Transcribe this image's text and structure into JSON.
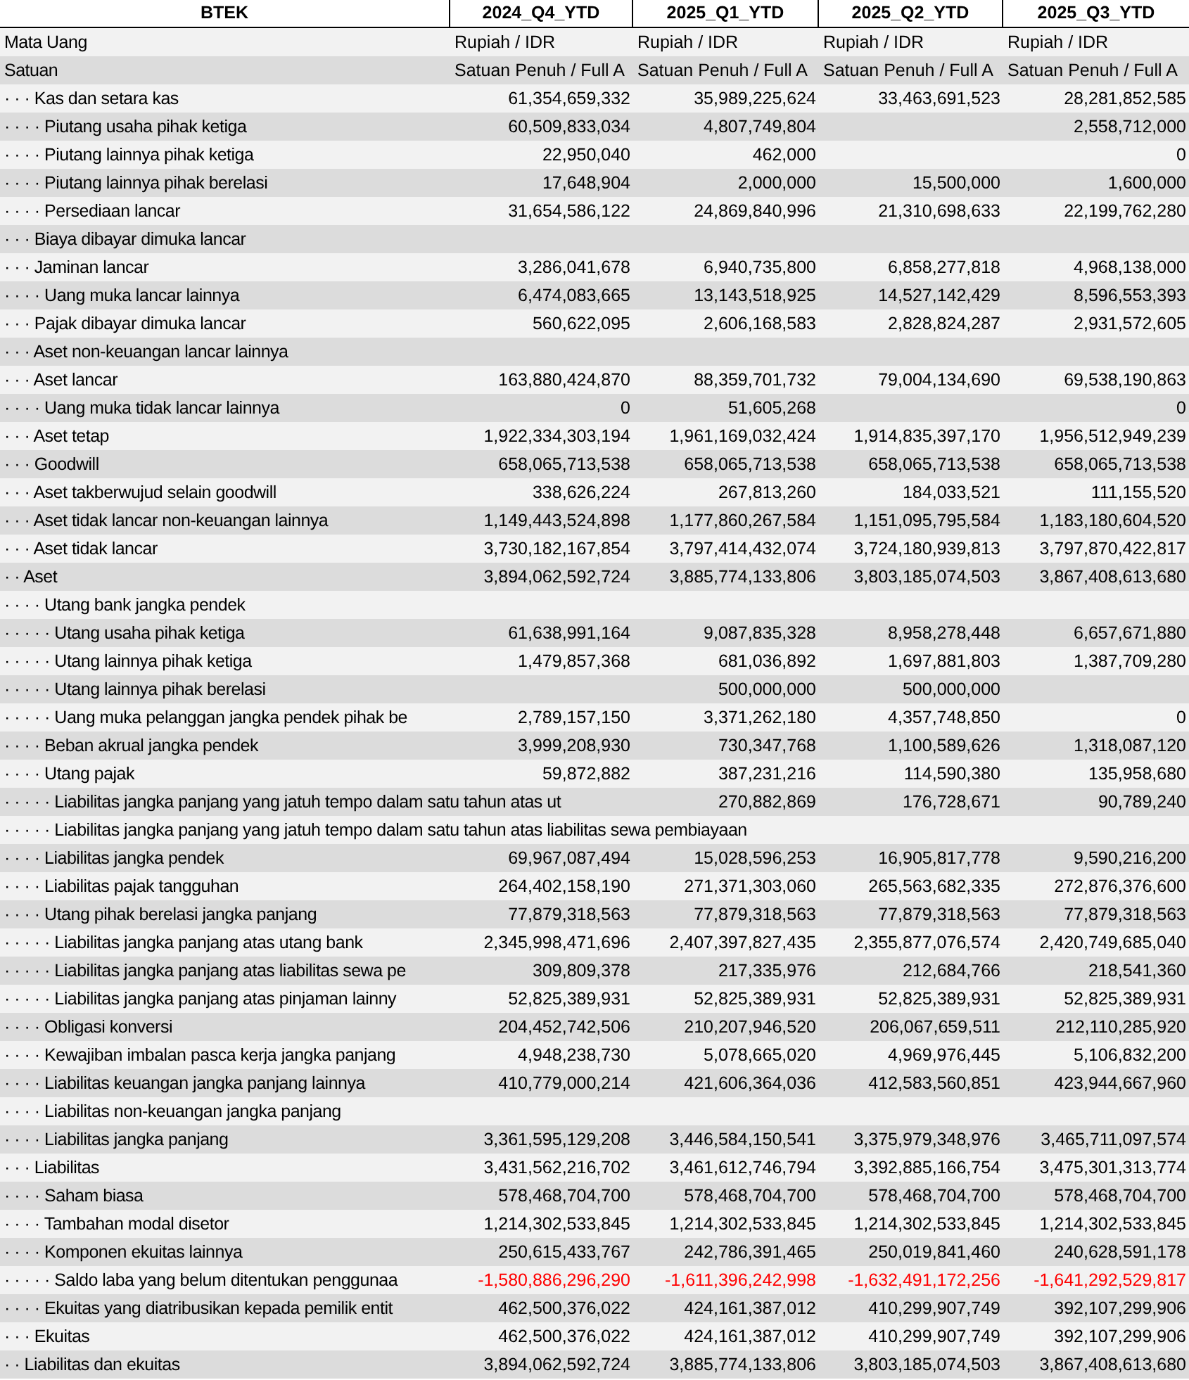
{
  "table": {
    "columns": [
      {
        "label": "BTEK"
      },
      {
        "label": "2024_Q4_YTD"
      },
      {
        "label": "2025_Q1_YTD"
      },
      {
        "label": "2025_Q2_YTD"
      },
      {
        "label": "2025_Q3_YTD"
      }
    ],
    "rows": [
      {
        "label": "Mata Uang",
        "values": {
          "col_1": "Rupiah / IDR",
          "col_2": "Rupiah / IDR",
          "col_3": "Rupiah / IDR",
          "col_4": "Rupiah / IDR"
        }
      },
      {
        "label": "Satuan",
        "values": {
          "col_1": "Satuan Penuh / Full A",
          "col_2": "Satuan Penuh / Full A",
          "col_3": "Satuan Penuh / Full A",
          "col_4": "Satuan Penuh / Full A"
        }
      },
      {
        "label": "· · · Kas dan setara kas",
        "values": {
          "col_1": "61,354,659,332",
          "col_2": "35,989,225,624",
          "col_3": "33,463,691,523",
          "col_4": "28,281,852,585"
        }
      },
      {
        "label": "· · · · Piutang usaha pihak ketiga",
        "values": {
          "col_1": "60,509,833,034",
          "col_2": "4,807,749,804",
          "col_4": "2,558,712,000"
        }
      },
      {
        "label": "· · · · Piutang lainnya pihak ketiga",
        "values": {
          "col_1": "22,950,040",
          "col_2": "462,000",
          "col_4": "0"
        }
      },
      {
        "label": "· · · · Piutang lainnya pihak berelasi",
        "values": {
          "col_1": "17,648,904",
          "col_2": "2,000,000",
          "col_3": "15,500,000",
          "col_4": "1,600,000"
        }
      },
      {
        "label": "· · · · Persediaan lancar",
        "values": {
          "col_1": "31,654,586,122",
          "col_2": "24,869,840,996",
          "col_3": "21,310,698,633",
          "col_4": "22,199,762,280"
        }
      },
      {
        "label": "· · · Biaya dibayar dimuka lancar"
      },
      {
        "label": "· · · Jaminan lancar",
        "values": {
          "col_1": "3,286,041,678",
          "col_2": "6,940,735,800",
          "col_3": "6,858,277,818",
          "col_4": "4,968,138,000"
        }
      },
      {
        "label": "· · · · Uang muka lancar lainnya",
        "values": {
          "col_1": "6,474,083,665",
          "col_2": "13,143,518,925",
          "col_3": "14,527,142,429",
          "col_4": "8,596,553,393"
        }
      },
      {
        "label": "· · · Pajak dibayar dimuka lancar",
        "values": {
          "col_1": "560,622,095",
          "col_2": "2,606,168,583",
          "col_3": "2,828,824,287",
          "col_4": "2,931,572,605"
        }
      },
      {
        "label": "· · · Aset non-keuangan lancar lainnya"
      },
      {
        "label": "· · · Aset lancar",
        "values": {
          "col_1": "163,880,424,870",
          "col_2": "88,359,701,732",
          "col_3": "79,004,134,690",
          "col_4": "69,538,190,863"
        }
      },
      {
        "label": "· · · · Uang muka tidak lancar lainnya",
        "values": {
          "col_1": "0",
          "col_2": "51,605,268",
          "col_4": "0"
        }
      },
      {
        "label": "· · · Aset tetap",
        "values": {
          "col_1": "1,922,334,303,194",
          "col_2": "1,961,169,032,424",
          "col_3": "1,914,835,397,170",
          "col_4": "1,956,512,949,239"
        }
      },
      {
        "label": "· · · Goodwill",
        "values": {
          "col_1": "658,065,713,538",
          "col_2": "658,065,713,538",
          "col_3": "658,065,713,538",
          "col_4": "658,065,713,538"
        }
      },
      {
        "label": "· · · Aset takberwujud selain goodwill",
        "values": {
          "col_1": "338,626,224",
          "col_2": "267,813,260",
          "col_3": "184,033,521",
          "col_4": "111,155,520"
        }
      },
      {
        "label": "· · · Aset tidak lancar non-keuangan lainnya",
        "values": {
          "col_1": "1,149,443,524,898",
          "col_2": "1,177,860,267,584",
          "col_3": "1,151,095,795,584",
          "col_4": "1,183,180,604,520"
        }
      },
      {
        "label": "· · · Aset tidak lancar",
        "values": {
          "col_1": "3,730,182,167,854",
          "col_2": "3,797,414,432,074",
          "col_3": "3,724,180,939,813",
          "col_4": "3,797,870,422,817"
        }
      },
      {
        "label": "· · Aset",
        "values": {
          "col_1": "3,894,062,592,724",
          "col_2": "3,885,774,133,806",
          "col_3": "3,803,185,074,503",
          "col_4": "3,867,408,613,680"
        }
      },
      {
        "label": "· · · · Utang bank jangka pendek"
      },
      {
        "label": "· · · · · Utang usaha pihak ketiga",
        "values": {
          "col_1": "61,638,991,164",
          "col_2": "9,087,835,328",
          "col_3": "8,958,278,448",
          "col_4": "6,657,671,880"
        }
      },
      {
        "label": "· · · · · Utang lainnya pihak ketiga",
        "values": {
          "col_1": "1,479,857,368",
          "col_2": "681,036,892",
          "col_3": "1,697,881,803",
          "col_4": "1,387,709,280"
        }
      },
      {
        "label": "· · · · · Utang lainnya pihak berelasi",
        "values": {
          "col_2": "500,000,000",
          "col_3": "500,000,000"
        }
      },
      {
        "label": "· · · · · Uang muka pelanggan jangka pendek pihak be",
        "values": {
          "col_1": "2,789,157,150",
          "col_2": "3,371,262,180",
          "col_3": "4,357,748,850",
          "col_4": "0"
        }
      },
      {
        "label": "· · · · Beban akrual jangka pendek",
        "values": {
          "col_1": "3,999,208,930",
          "col_2": "730,347,768",
          "col_3": "1,100,589,626",
          "col_4": "1,318,087,120"
        }
      },
      {
        "label": "· · · · Utang pajak",
        "values": {
          "col_1": "59,872,882",
          "col_2": "387,231,216",
          "col_3": "114,590,380",
          "col_4": "135,958,680"
        }
      },
      {
        "label": "· · · · · Liabilitas jangka panjang yang jatuh tempo dalam satu tahun atas ut",
        "values": {
          "col_2": "270,882,869",
          "col_3": "176,728,671",
          "col_4": "90,789,240"
        }
      },
      {
        "label": "· · · · · Liabilitas jangka panjang yang jatuh tempo dalam satu tahun atas liabilitas sewa pembiayaan"
      },
      {
        "label": "· · · · Liabilitas jangka pendek",
        "values": {
          "col_1": "69,967,087,494",
          "col_2": "15,028,596,253",
          "col_3": "16,905,817,778",
          "col_4": "9,590,216,200"
        }
      },
      {
        "label": "· · · · Liabilitas pajak tangguhan",
        "values": {
          "col_1": "264,402,158,190",
          "col_2": "271,371,303,060",
          "col_3": "265,563,682,335",
          "col_4": "272,876,376,600"
        }
      },
      {
        "label": "· · · · Utang pihak berelasi jangka panjang",
        "values": {
          "col_1": "77,879,318,563",
          "col_2": "77,879,318,563",
          "col_3": "77,879,318,563",
          "col_4": "77,879,318,563"
        }
      },
      {
        "label": "· · · · · Liabilitas jangka panjang atas utang bank",
        "values": {
          "col_1": "2,345,998,471,696",
          "col_2": "2,407,397,827,435",
          "col_3": "2,355,877,076,574",
          "col_4": "2,420,749,685,040"
        }
      },
      {
        "label": "· · · · · Liabilitas jangka panjang atas liabilitas sewa pe",
        "values": {
          "col_1": "309,809,378",
          "col_2": "217,335,976",
          "col_3": "212,684,766",
          "col_4": "218,541,360"
        }
      },
      {
        "label": "· · · · · Liabilitas jangka panjang atas pinjaman lainny",
        "values": {
          "col_1": "52,825,389,931",
          "col_2": "52,825,389,931",
          "col_3": "52,825,389,931",
          "col_4": "52,825,389,931"
        }
      },
      {
        "label": "· · · · Obligasi konversi",
        "values": {
          "col_1": "204,452,742,506",
          "col_2": "210,207,946,520",
          "col_3": "206,067,659,511",
          "col_4": "212,110,285,920"
        }
      },
      {
        "label": "· · · · Kewajiban imbalan pasca kerja jangka panjang",
        "values": {
          "col_1": "4,948,238,730",
          "col_2": "5,078,665,020",
          "col_3": "4,969,976,445",
          "col_4": "5,106,832,200"
        }
      },
      {
        "label": "· · · · Liabilitas keuangan jangka panjang lainnya",
        "values": {
          "col_1": "410,779,000,214",
          "col_2": "421,606,364,036",
          "col_3": "412,583,560,851",
          "col_4": "423,944,667,960"
        }
      },
      {
        "label": "· · · · Liabilitas non-keuangan jangka panjang"
      },
      {
        "label": "· · · · Liabilitas jangka panjang",
        "values": {
          "col_1": "3,361,595,129,208",
          "col_2": "3,446,584,150,541",
          "col_3": "3,375,979,348,976",
          "col_4": "3,465,711,097,574"
        }
      },
      {
        "label": "· · · Liabilitas",
        "values": {
          "col_1": "3,431,562,216,702",
          "col_2": "3,461,612,746,794",
          "col_3": "3,392,885,166,754",
          "col_4": "3,475,301,313,774"
        }
      },
      {
        "label": "· · · · Saham biasa",
        "values": {
          "col_1": "578,468,704,700",
          "col_2": "578,468,704,700",
          "col_3": "578,468,704,700",
          "col_4": "578,468,704,700"
        }
      },
      {
        "label": "· · · · Tambahan modal disetor",
        "values": {
          "col_1": "1,214,302,533,845",
          "col_2": "1,214,302,533,845",
          "col_3": "1,214,302,533,845",
          "col_4": "1,214,302,533,845"
        }
      },
      {
        "label": "· · · · Komponen ekuitas lainnya",
        "values": {
          "col_1": "250,615,433,767",
          "col_2": "242,786,391,465",
          "col_3": "250,019,841,460",
          "col_4": "240,628,591,178"
        }
      },
      {
        "label": "· · · · · Saldo laba yang belum ditentukan penggunaa",
        "values": {
          "col_1": "-1,580,886,296,290",
          "col_2": "-1,611,396,242,998",
          "col_3": "-1,632,491,172,256",
          "col_4": "-1,641,292,529,817"
        },
        "color": "#ff0000"
      },
      {
        "label": "· · · · Ekuitas yang diatribusikan kepada pemilik entit",
        "values": {
          "col_1": "462,500,376,022",
          "col_2": "424,161,387,012",
          "col_3": "410,299,907,749",
          "col_4": "392,107,299,906"
        }
      },
      {
        "label": "· · · Ekuitas",
        "values": {
          "col_1": "462,500,376,022",
          "col_2": "424,161,387,012",
          "col_3": "410,299,907,749",
          "col_4": "392,107,299,906"
        }
      },
      {
        "label": "· · Liabilitas dan ekuitas",
        "values": {
          "col_1": "3,894,062,592,724",
          "col_2": "3,885,774,133,806",
          "col_3": "3,803,185,074,503",
          "col_4": "3,867,408,613,680"
        }
      }
    ]
  }
}
